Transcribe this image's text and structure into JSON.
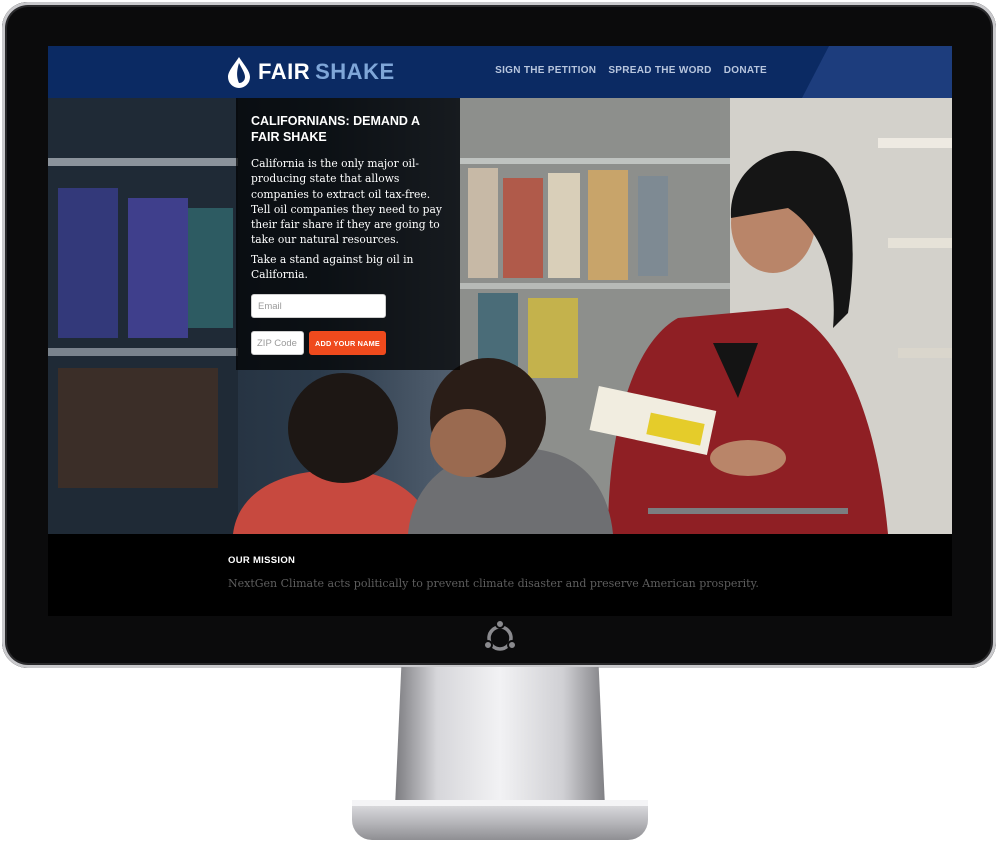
{
  "header": {
    "brand_primary": "FAIR",
    "brand_secondary": "SHAKE",
    "logo_icon": "oil-drop-icon",
    "nav": [
      "SIGN THE PETITION",
      "SPREAD THE WORD",
      "DONATE"
    ]
  },
  "hero": {
    "headline": "CALIFORNIANS: DEMAND A FAIR SHAKE",
    "body": "California is the only major oil-producing state that allows companies to extract oil tax-free. Tell oil companies they need to pay their fair share if they are going to take our natural resources.",
    "subtext": "Take a stand against big oil in California.",
    "email_placeholder": "Email",
    "zip_placeholder": "ZIP Code",
    "submit_label": "ADD YOUR NAME",
    "image": "mother-with-children-in-grocery-store-photo"
  },
  "mission": {
    "heading": "OUR MISSION",
    "text": "NextGen Climate acts politically to prevent climate disaster and preserve American prosperity."
  },
  "device": {
    "bezel_icon": "ubuntu-logo-icon"
  },
  "colors": {
    "header_bg": "#0b2a63",
    "brand_light": "#7fa6d8",
    "button_accent": "#ef4a1d",
    "mission_bg": "#000000"
  }
}
